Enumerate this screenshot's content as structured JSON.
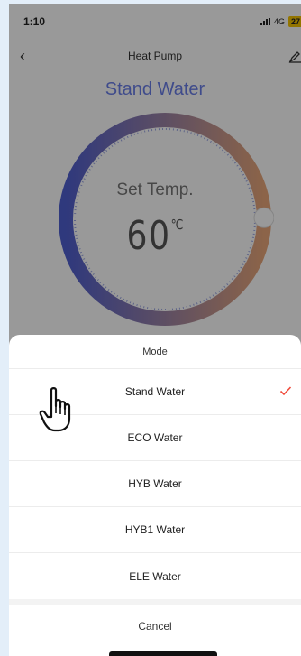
{
  "status": {
    "time": "1:10",
    "network": "4G",
    "battery": "27"
  },
  "header": {
    "title": "Heat Pump"
  },
  "main": {
    "mode_title": "Stand Water",
    "set_label": "Set Temp.",
    "temperature": "60",
    "temp_unit": "℃",
    "dial_level": 0.83
  },
  "sheet": {
    "title": "Mode",
    "options": [
      {
        "label": "Stand Water",
        "selected": true
      },
      {
        "label": "ECO Water",
        "selected": false
      },
      {
        "label": "HYB Water",
        "selected": false
      },
      {
        "label": "HYB1 Water",
        "selected": false
      },
      {
        "label": "ELE Water",
        "selected": false
      }
    ],
    "cancel": "Cancel"
  },
  "colors": {
    "accent": "#6a7ee8",
    "check": "#f04a3a",
    "dial_start": "#4f5fd0",
    "dial_end": "#e9a77a"
  },
  "icons": [
    "back-icon",
    "edit-icon",
    "check-icon",
    "hand-pointer-icon"
  ]
}
